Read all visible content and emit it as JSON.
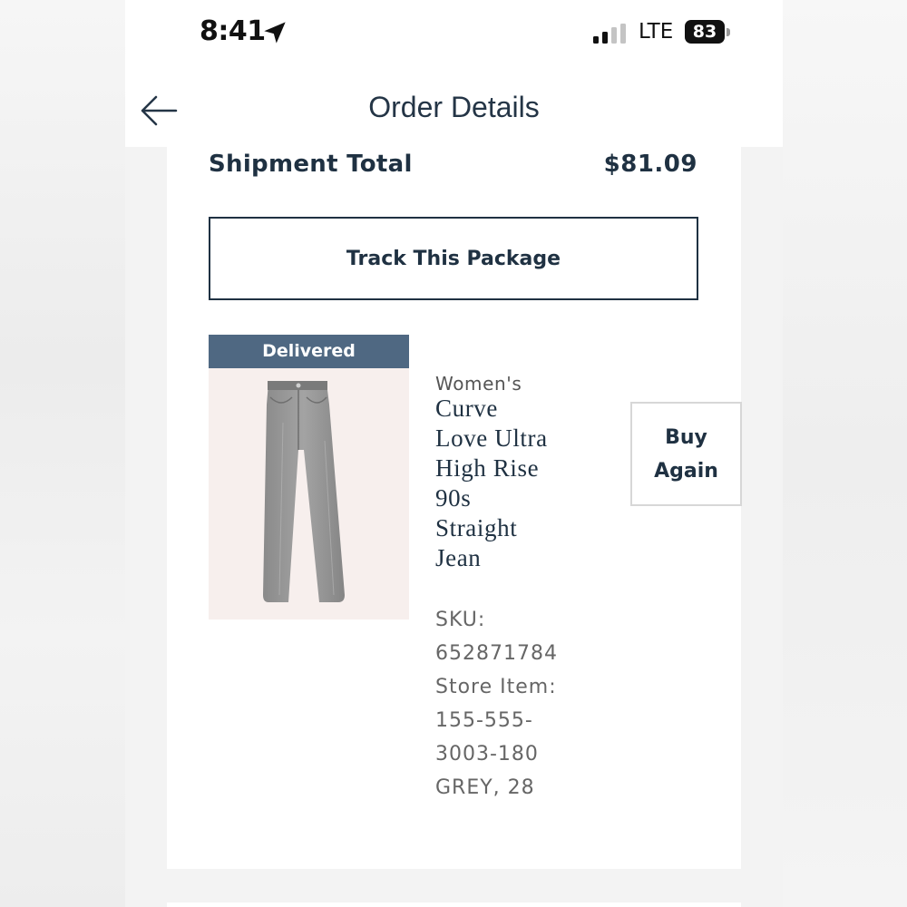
{
  "status_bar": {
    "time": "8:41",
    "network": "LTE",
    "battery": "83"
  },
  "header": {
    "title": "Order Details"
  },
  "shipment": {
    "label": "Shipment Total",
    "value": "$81.09"
  },
  "track_button": {
    "label": "Track This Package"
  },
  "item": {
    "status": "Delivered",
    "category": "Women's",
    "name_lines": [
      "Curve",
      "Love Ultra",
      "High Rise",
      "90s",
      "Straight",
      "Jean"
    ],
    "buy_again_lines": [
      "Buy",
      "Again"
    ],
    "meta_lines": [
      "SKU:",
      "652871784",
      "Store Item:",
      "155-555-",
      "3003-180",
      "GREY, 28"
    ]
  },
  "colors": {
    "navy": "#1f3142",
    "badge": "#4f6882",
    "image_bg": "#f7efed"
  },
  "icons": {
    "back": "arrow-left-icon",
    "location": "location-arrow-icon",
    "signal": "cellular-signal-icon",
    "battery": "battery-icon"
  }
}
